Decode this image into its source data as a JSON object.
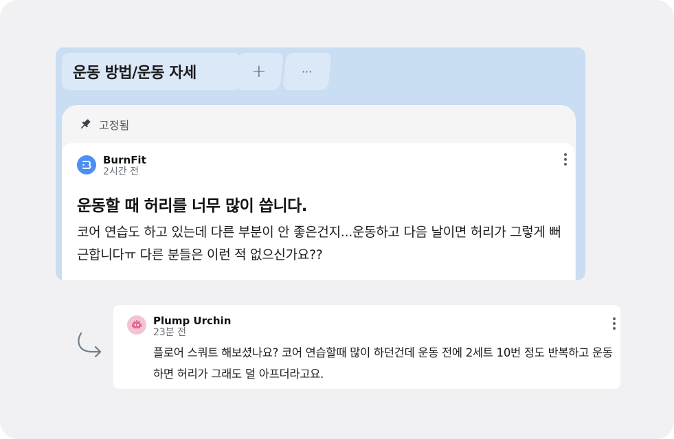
{
  "board": {
    "tab_title": "운동 방법/운동 자세",
    "add_tab_label": "+",
    "more_tab_label": "···"
  },
  "pinned": {
    "label": "고정됨",
    "icon": "pin-icon"
  },
  "post": {
    "author": "BurnFit",
    "time": "2시간 전",
    "title": "운동할 때 허리를 너무 많이 씁니다.",
    "body": "코어 연습도 하고 있는데 다른 부분이 안 좋은건지...운동하고 다음 날이면 허리가 그렇게 뻐근합니다ㅠ 다른 분들은 이런 적 없으신가요??",
    "avatar_color": "#4d8ff2"
  },
  "comment": {
    "author": "Plump Urchin",
    "time": "23분 전",
    "body": "플로어 스쿼트 해보셨나요? 코어 연습할때 많이 하던건데 운동 전에 2세트 10번 정도 반복하고 운동하면 허리가 그래도 덜 아프더라고요.",
    "avatar_color": "#f3c4d5"
  },
  "colors": {
    "panel_bg": "#c9ddf3",
    "tab_bg": "#dbe8f7",
    "page_bg": "#f1f1f3"
  }
}
